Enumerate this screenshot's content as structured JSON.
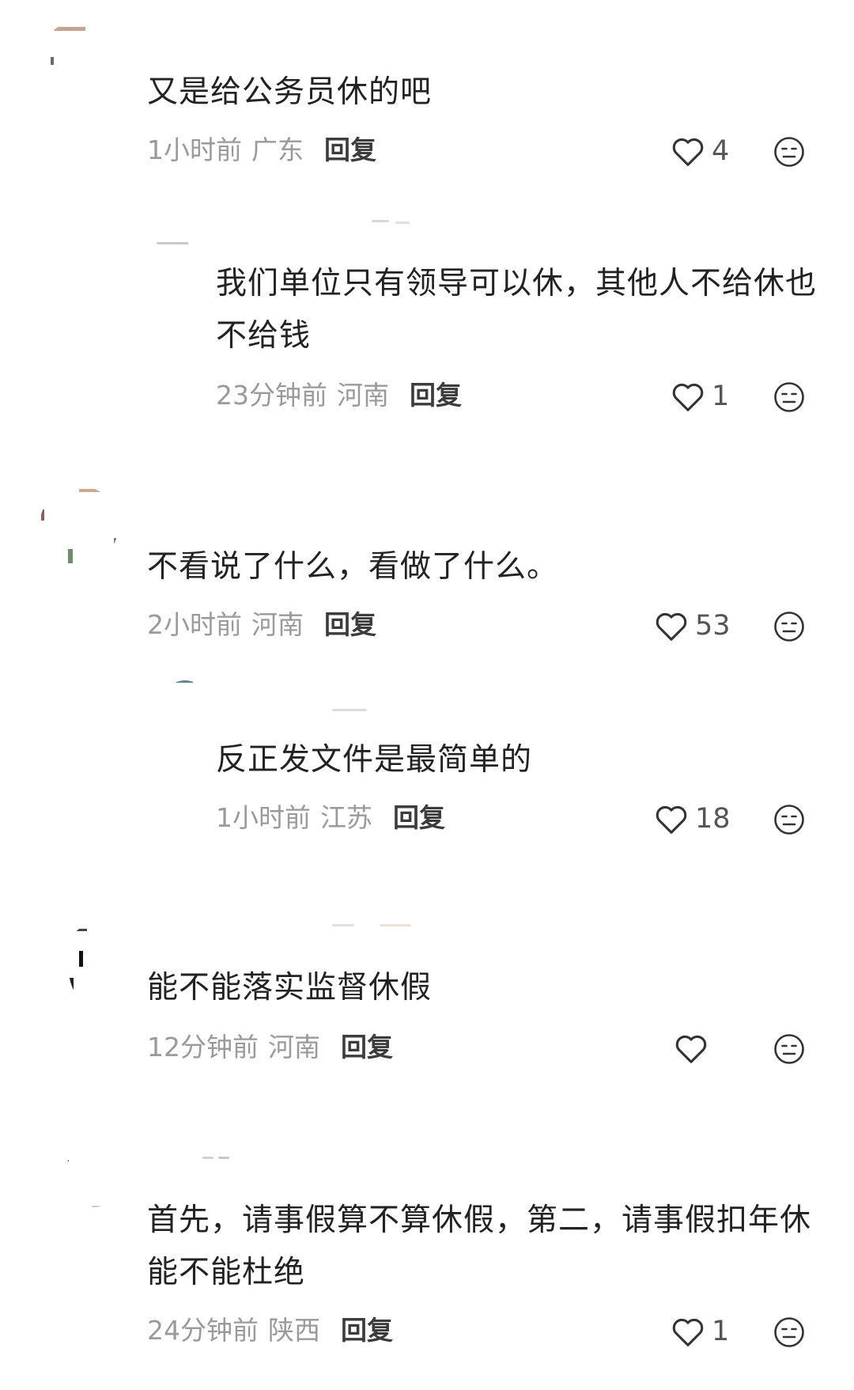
{
  "comments": [
    {
      "text": "又是给公务员休的吧",
      "time": "1小时前",
      "location": "广东",
      "reply": "回复",
      "likes": "4"
    },
    {
      "text": "我们单位只有领导可以休，其他人不给休也不给钱",
      "time": "23分钟前",
      "location": "河南",
      "reply": "回复",
      "likes": "1"
    },
    {
      "text": "不看说了什么，看做了什么。",
      "time": "2小时前",
      "location": "河南",
      "reply": "回复",
      "likes": "53"
    },
    {
      "text": "反正发文件是最简单的",
      "time": "1小时前",
      "location": "江苏",
      "reply": "回复",
      "likes": "18"
    },
    {
      "text": "能不能落实监督休假",
      "time": "12分钟前",
      "location": "河南",
      "reply": "回复",
      "likes": ""
    },
    {
      "text": "首先，请事假算不算休假，第二，请事假扣年休能不能杜绝",
      "time": "24分钟前",
      "location": "陕西",
      "reply": "回复",
      "likes": "1"
    }
  ],
  "icons": {
    "like": "heart-outline-icon",
    "reaction": "neutral-face-icon"
  },
  "colors": {
    "text": "#222222",
    "meta": "#9a9a9a",
    "reply": "#3c3c3c",
    "icon": "#333333"
  }
}
